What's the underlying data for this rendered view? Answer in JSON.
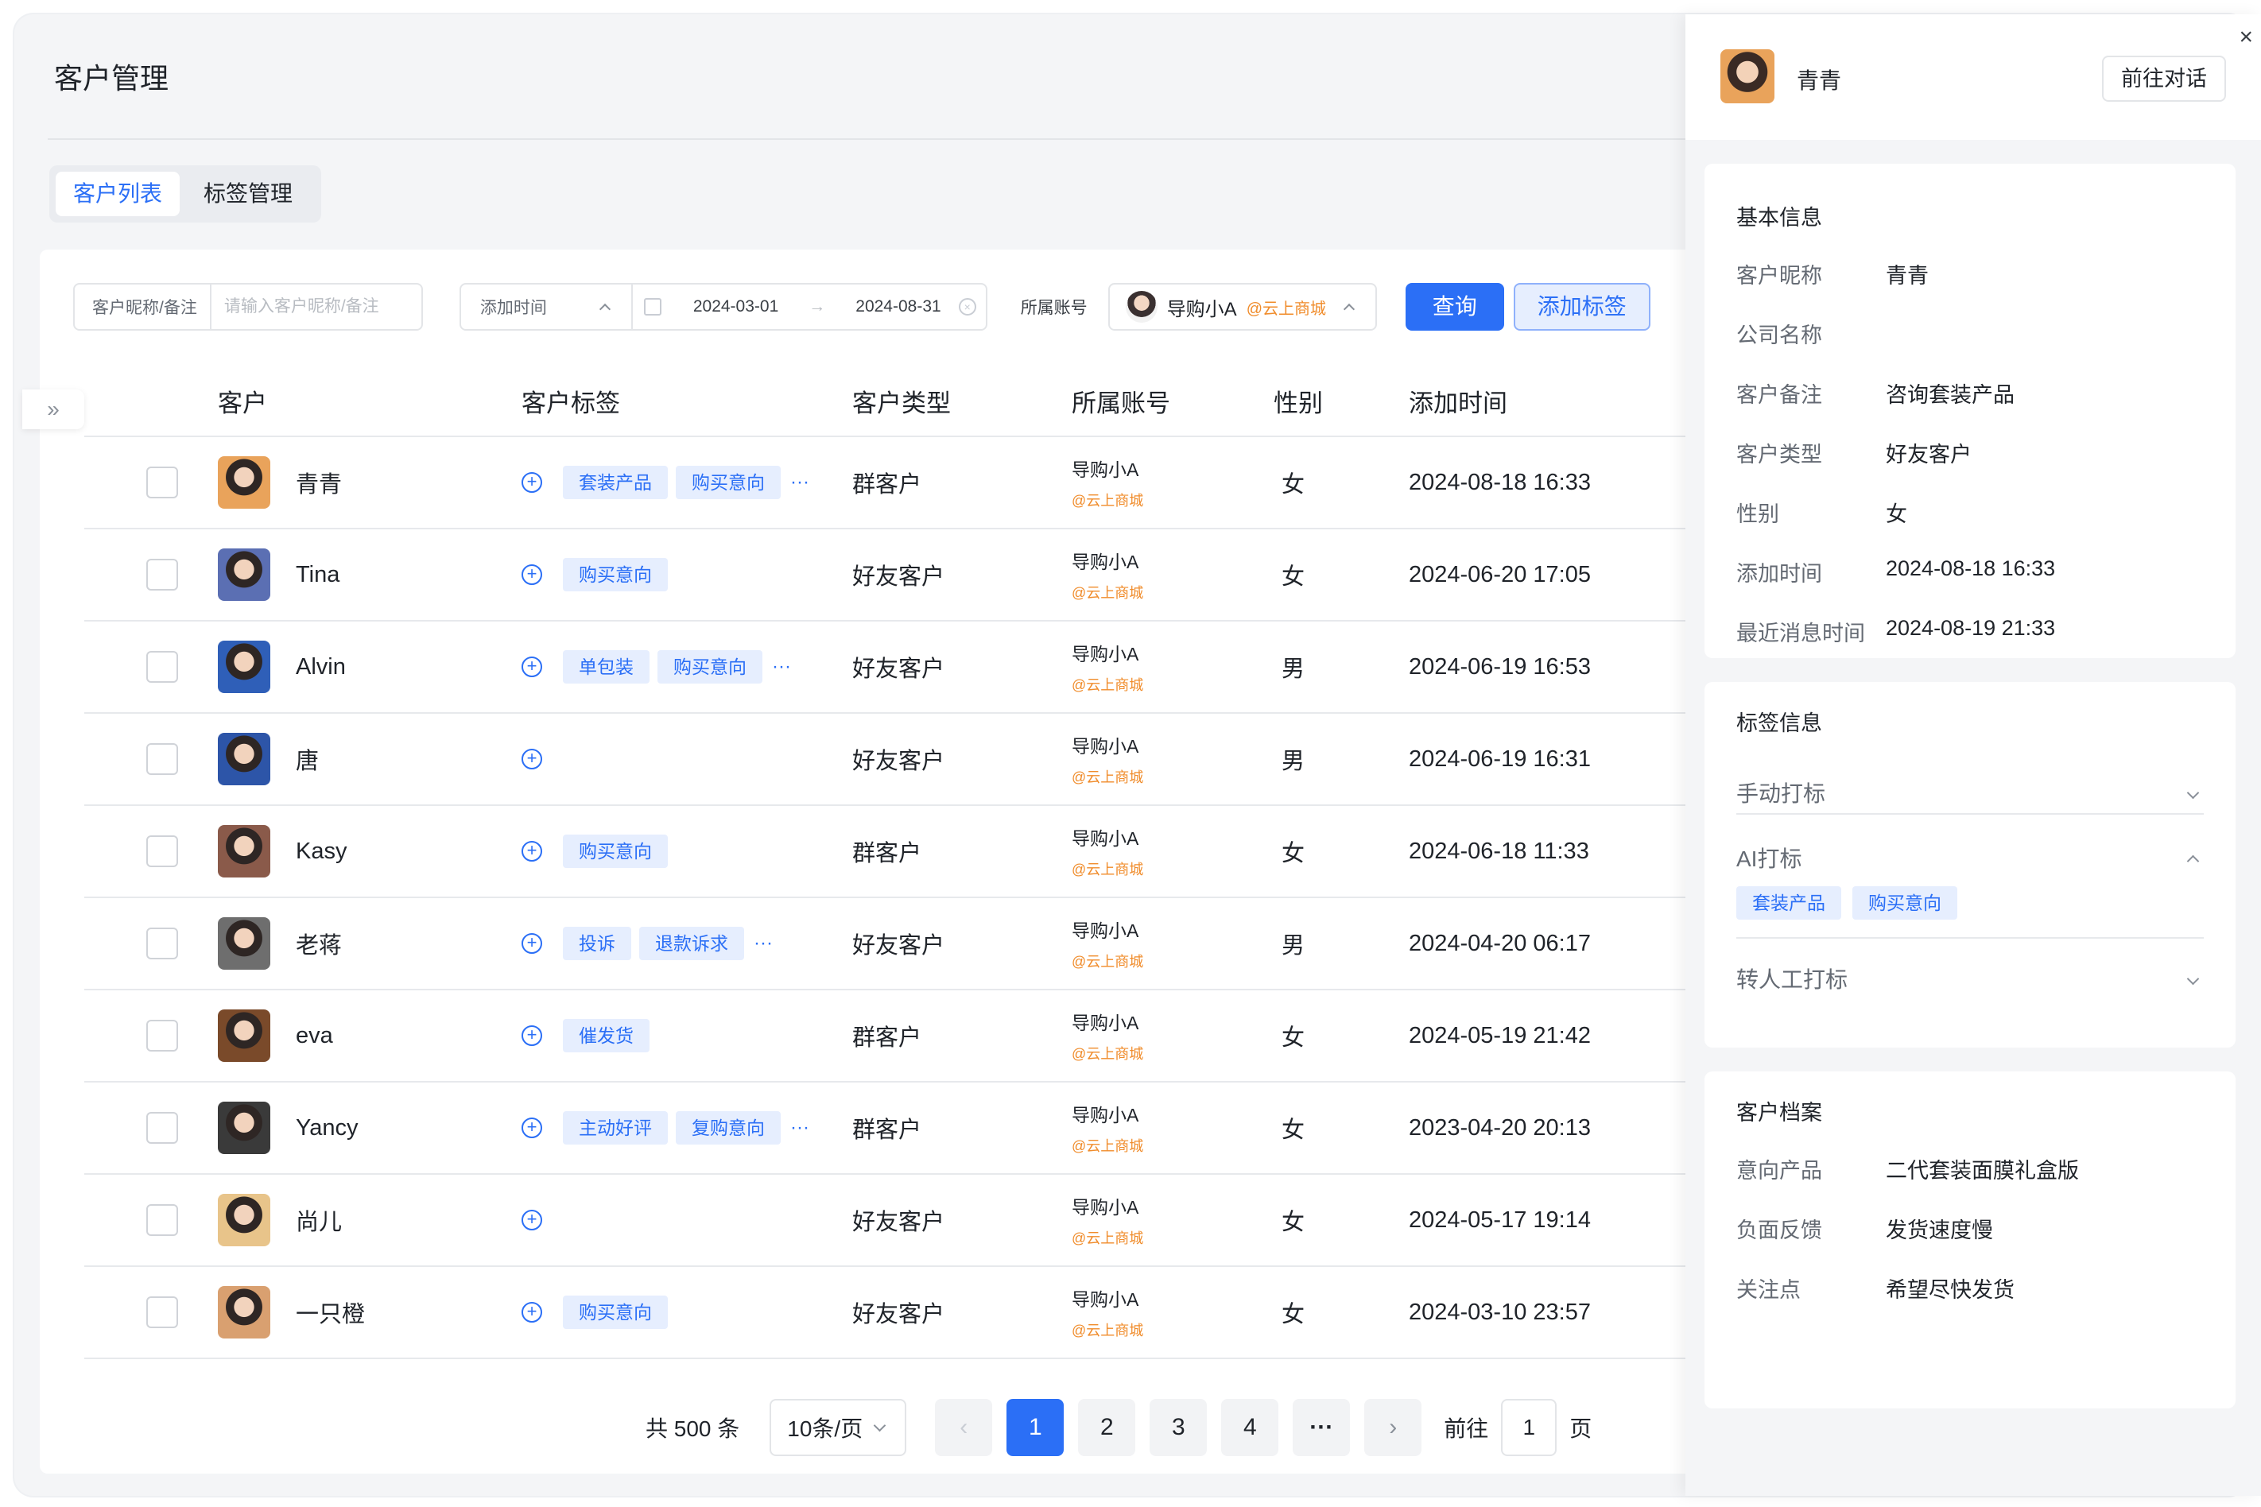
{
  "page": {
    "title": "客户管理"
  },
  "tabs": [
    {
      "label": "客户列表",
      "active": true
    },
    {
      "label": "标签管理",
      "active": false
    }
  ],
  "filters": {
    "nickname_label": "客户昵称/备注",
    "nickname_placeholder": "请输入客户昵称/备注",
    "time_select": "添加时间",
    "date_start": "2024-03-01",
    "date_end": "2024-08-31",
    "account_label": "所属账号",
    "account_name": "导购小A",
    "account_shop": "@云上商城",
    "query_button": "查询",
    "add_tag_button": "添加标签"
  },
  "table": {
    "headers": {
      "customer": "客户",
      "tags": "客户标签",
      "type": "客户类型",
      "account": "所属账号",
      "gender": "性别",
      "added": "添加时间"
    },
    "rows": [
      {
        "name": "青青",
        "tags": [
          "套装产品",
          "购买意向"
        ],
        "more": true,
        "type": "群客户",
        "account": "导购小A",
        "shop": "@云上商城",
        "gender": "女",
        "added": "2024-08-18  16:33",
        "avatar": "#e9a35b"
      },
      {
        "name": "Tina",
        "tags": [
          "购买意向"
        ],
        "more": false,
        "type": "好友客户",
        "account": "导购小A",
        "shop": "@云上商城",
        "gender": "女",
        "added": "2024-06-20  17:05",
        "avatar": "#5b6fb3"
      },
      {
        "name": "Alvin",
        "tags": [
          "单包装",
          "购买意向"
        ],
        "more": true,
        "type": "好友客户",
        "account": "导购小A",
        "shop": "@云上商城",
        "gender": "男",
        "added": "2024-06-19  16:53",
        "avatar": "#2f5fb8"
      },
      {
        "name": "唐",
        "tags": [],
        "more": false,
        "type": "好友客户",
        "account": "导购小A",
        "shop": "@云上商城",
        "gender": "男",
        "added": "2024-06-19  16:31",
        "avatar": "#2d55a8"
      },
      {
        "name": "Kasy",
        "tags": [
          "购买意向"
        ],
        "more": false,
        "type": "群客户",
        "account": "导购小A",
        "shop": "@云上商城",
        "gender": "女",
        "added": "2024-06-18  11:33",
        "avatar": "#8a5a4a"
      },
      {
        "name": "老蒋",
        "tags": [
          "投诉",
          "退款诉求"
        ],
        "more": true,
        "type": "好友客户",
        "account": "导购小A",
        "shop": "@云上商城",
        "gender": "男",
        "added": "2024-04-20  06:17",
        "avatar": "#6e6e6e"
      },
      {
        "name": "eva",
        "tags": [
          "催发货"
        ],
        "more": false,
        "type": "群客户",
        "account": "导购小A",
        "shop": "@云上商城",
        "gender": "女",
        "added": "2024-05-19  21:42",
        "avatar": "#7a4a2a"
      },
      {
        "name": "Yancy",
        "tags": [
          "主动好评",
          "复购意向"
        ],
        "more": true,
        "type": "群客户",
        "account": "导购小A",
        "shop": "@云上商城",
        "gender": "女",
        "added": "2023-04-20  20:13",
        "avatar": "#3a3a3a"
      },
      {
        "name": "尚儿",
        "tags": [],
        "more": false,
        "type": "好友客户",
        "account": "导购小A",
        "shop": "@云上商城",
        "gender": "女",
        "added": "2024-05-17  19:14",
        "avatar": "#e8c48a"
      },
      {
        "name": "一只橙",
        "tags": [
          "购买意向"
        ],
        "more": false,
        "type": "好友客户",
        "account": "导购小A",
        "shop": "@云上商城",
        "gender": "女",
        "added": "2024-03-10  23:57",
        "avatar": "#d9a070"
      }
    ]
  },
  "pagination": {
    "total": "共 500 条",
    "page_size": "10条/页",
    "pages": [
      "1",
      "2",
      "3",
      "4"
    ],
    "ellipsis": "···",
    "current": "1",
    "goto_label": "前往",
    "goto_value": "1",
    "page_suffix": "页"
  },
  "drawer": {
    "name": "青青",
    "goto_chat": "前往对话",
    "close": "×",
    "basic": {
      "title": "基本信息",
      "fields": [
        {
          "k": "客户昵称",
          "v": "青青"
        },
        {
          "k": "公司名称",
          "v": ""
        },
        {
          "k": "客户备注",
          "v": "咨询套装产品"
        },
        {
          "k": "客户类型",
          "v": "好友客户"
        },
        {
          "k": "性别",
          "v": "女"
        },
        {
          "k": "添加时间",
          "v": "2024-08-18  16:33"
        },
        {
          "k": "最近消息时间",
          "v": "2024-08-19  21:33"
        }
      ]
    },
    "tags": {
      "title": "标签信息",
      "manual": "手动打标",
      "ai": "AI打标",
      "ai_tags": [
        "套装产品",
        "购买意向"
      ],
      "human": "转人工打标"
    },
    "profile": {
      "title": "客户档案",
      "fields": [
        {
          "k": "意向产品",
          "v": "二代套装面膜礼盒版"
        },
        {
          "k": "负面反馈",
          "v": "发货速度慢"
        },
        {
          "k": "关注点",
          "v": "希望尽快发货"
        }
      ]
    }
  },
  "colors": {
    "accent": "#2b6ff6",
    "tag_bg": "#e6eefe",
    "shop": "#f08c2b"
  },
  "icons": {
    "collapse": "double-chevron-right-icon",
    "calendar": "calendar-icon",
    "plus": "plus-circle-icon"
  }
}
